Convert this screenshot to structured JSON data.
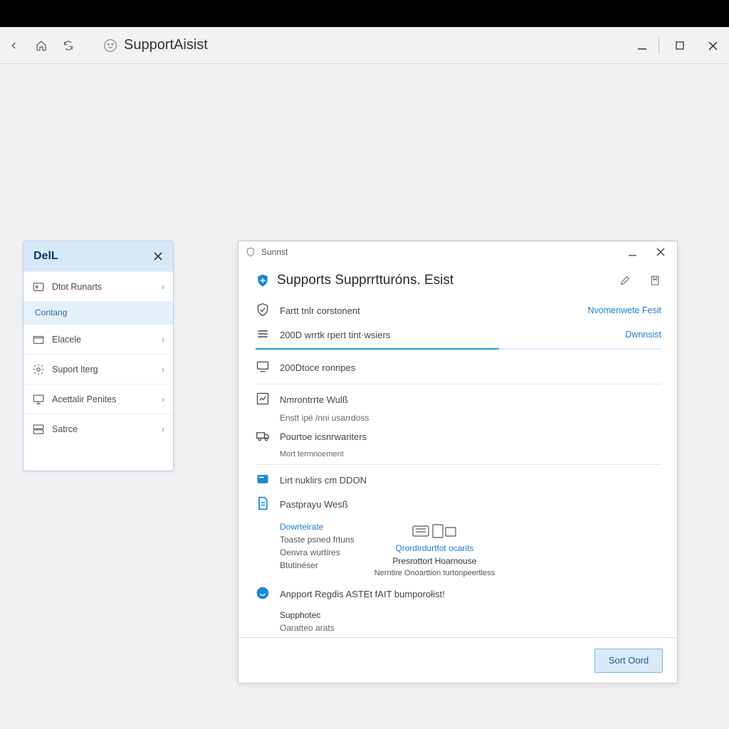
{
  "header": {
    "app_title": "SupportAisist"
  },
  "sidebar": {
    "brand": "DelL",
    "items": [
      {
        "label": "Dtot Runarts"
      },
      {
        "label": "Contang"
      },
      {
        "label": "Elacele"
      },
      {
        "label": "Suport lterg"
      },
      {
        "label": "Acettalir Penites"
      },
      {
        "label": "Satrce"
      }
    ]
  },
  "dialog": {
    "caption": "Sunnst",
    "title": "Supports Supprrtturóns. Esist",
    "links": {
      "top_right": "Nvomenwete Fesit",
      "download": "Dwnnsist"
    },
    "rows": {
      "r1": "Fartt tnlr corstonent",
      "r2": "200D wrrtk rpert tint·wsiers",
      "r3": "200Dtoce ronnpes",
      "r4": "Nmrontrrte Wulß",
      "r4s": "Enstt ipé /nni usarrdoss",
      "r5": "Pourtoe icsnrwariters",
      "r5s": "Mort termnoement",
      "r6": "Lirt nuklirs cm DDON",
      "r7": "Pastprayu Wesß",
      "r7a": "Dowrteirate",
      "r7b": "Toaste psned frtuns",
      "r7c": "Oenvra wurtires",
      "r7d": "Btutinéser",
      "mid_link": "Qrordirdurtfot ocarits",
      "mid_a": "Presrottort Hoarnouse",
      "mid_b": "Nerntire Onoarttion turtonpeertless",
      "r8": "Anpport Regdis ASTEt fAIT bumporołist!",
      "r9": "Supphotec",
      "r10": "Oaratteo arats"
    },
    "button": "Sort Oord"
  }
}
